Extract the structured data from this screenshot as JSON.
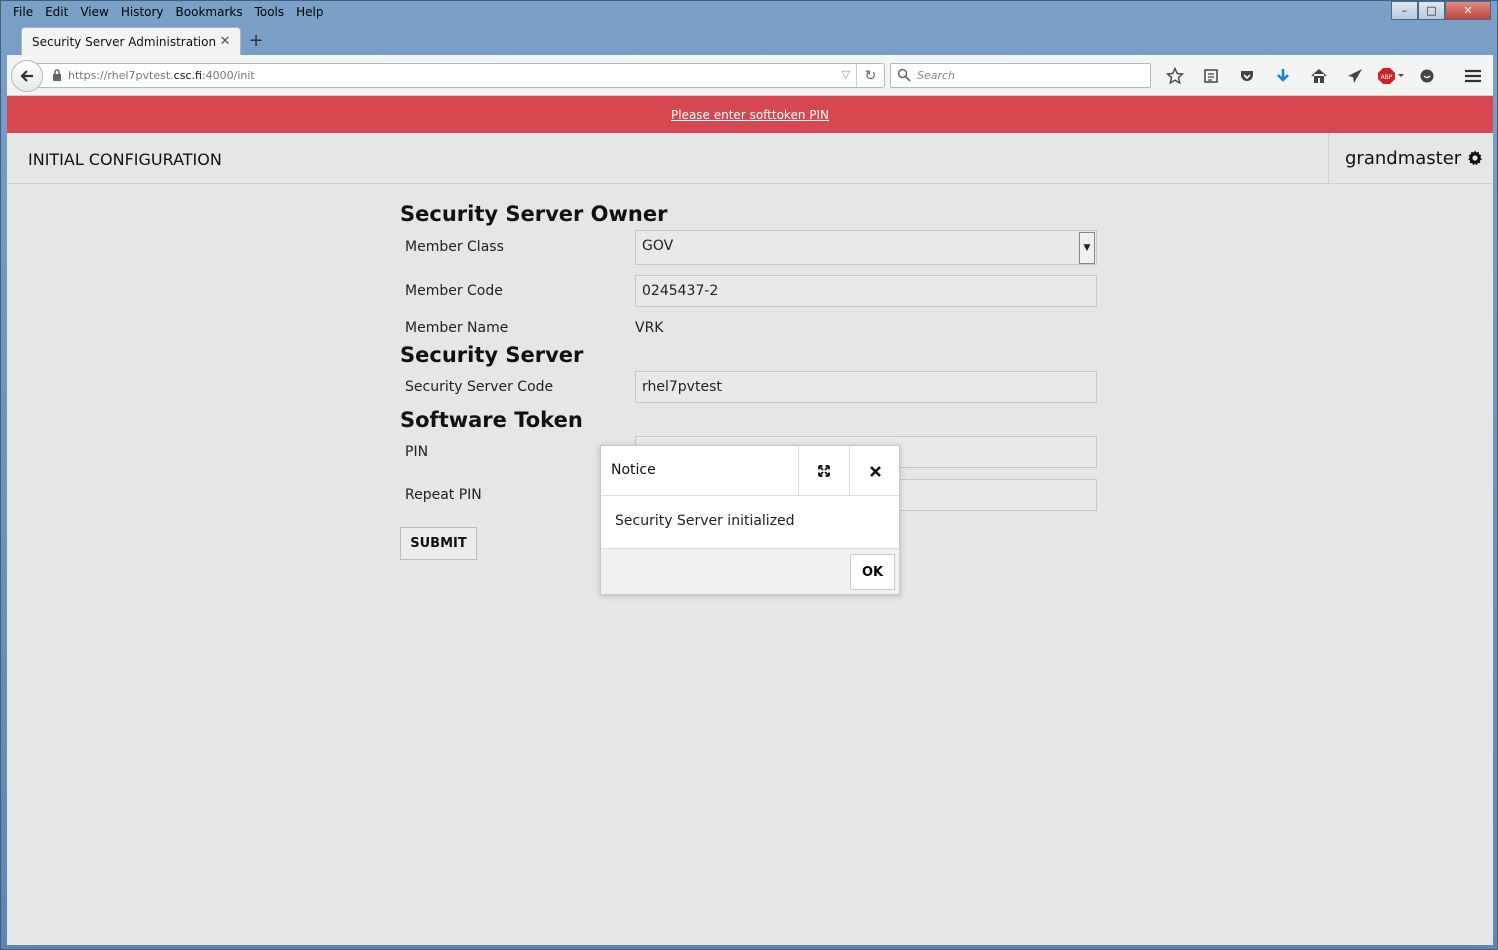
{
  "menu": [
    "File",
    "Edit",
    "View",
    "History",
    "Bookmarks",
    "Tools",
    "Help"
  ],
  "window_controls": {
    "minimize": "–",
    "maximize": "□",
    "close": "✕"
  },
  "tab": {
    "title": "Security Server Administration",
    "close": "✕",
    "new": "+"
  },
  "url": {
    "prefix": "https://rhel7pvtest.",
    "domain": "csc.fi",
    "suffix": ":4000/init"
  },
  "search": {
    "placeholder": "Search"
  },
  "alert": {
    "text": "Please enter softtoken PIN",
    "color": "#d6474f"
  },
  "header": {
    "title": "INITIAL CONFIGURATION",
    "user": "grandmaster"
  },
  "owner": {
    "title": "Security Server Owner",
    "member_class_label": "Member Class",
    "member_class_value": "GOV",
    "member_code_label": "Member Code",
    "member_code_value": "0245437-2",
    "member_name_label": "Member Name",
    "member_name_value": "VRK"
  },
  "server": {
    "title": "Security Server",
    "code_label": "Security Server Code",
    "code_value": "rhel7pvtest"
  },
  "token": {
    "title": "Software Token",
    "pin_label": "PIN",
    "repeat_pin_label": "Repeat PIN"
  },
  "submit_label": "SUBMIT",
  "dialog": {
    "title": "Notice",
    "message": "Security Server initialized",
    "ok_label": "OK"
  }
}
